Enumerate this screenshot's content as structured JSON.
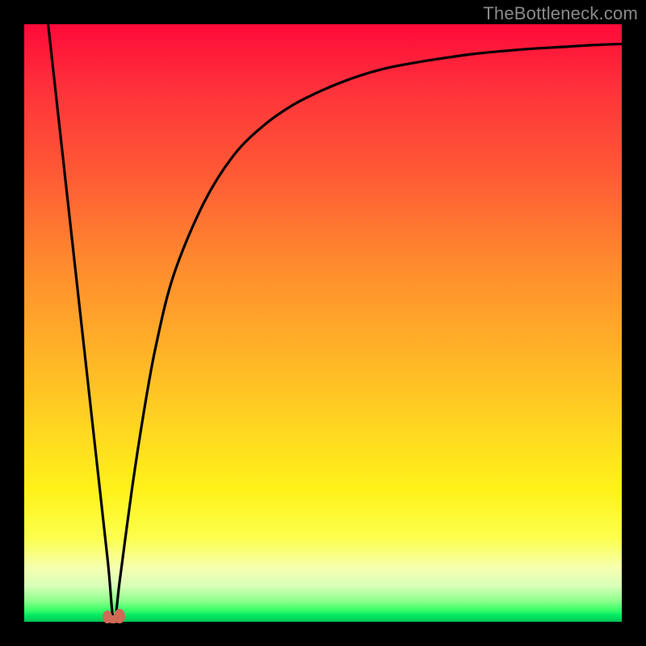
{
  "watermark": "TheBottleneck.com",
  "chart_data": {
    "type": "line",
    "title": "",
    "xlabel": "",
    "ylabel": "",
    "xlim": [
      0,
      100
    ],
    "ylim": [
      0,
      100
    ],
    "grid": false,
    "legend": false,
    "series": [
      {
        "name": "bottleneck-curve",
        "x": [
          4,
          6,
          8,
          10,
          12,
          14,
          15,
          16,
          18,
          20,
          22,
          25,
          30,
          35,
          40,
          45,
          50,
          55,
          60,
          65,
          70,
          75,
          80,
          85,
          90,
          95,
          100
        ],
        "y": [
          100,
          82,
          64,
          46,
          28,
          10,
          0,
          7,
          22,
          35,
          46,
          58,
          70,
          78,
          83,
          86.5,
          89,
          91,
          92.5,
          93.5,
          94.3,
          95,
          95.5,
          95.9,
          96.2,
          96.5,
          96.7
        ]
      }
    ],
    "annotations": [
      {
        "name": "min-marker",
        "x": 15,
        "y": 0
      }
    ],
    "background_gradient": {
      "orientation": "vertical",
      "stops": [
        {
          "pos": 0.0,
          "color": "#ff0a3a"
        },
        {
          "pos": 0.55,
          "color": "#ffb327"
        },
        {
          "pos": 0.78,
          "color": "#fff21a"
        },
        {
          "pos": 0.94,
          "color": "#d8ffb8"
        },
        {
          "pos": 1.0,
          "color": "#00c455"
        }
      ]
    }
  }
}
